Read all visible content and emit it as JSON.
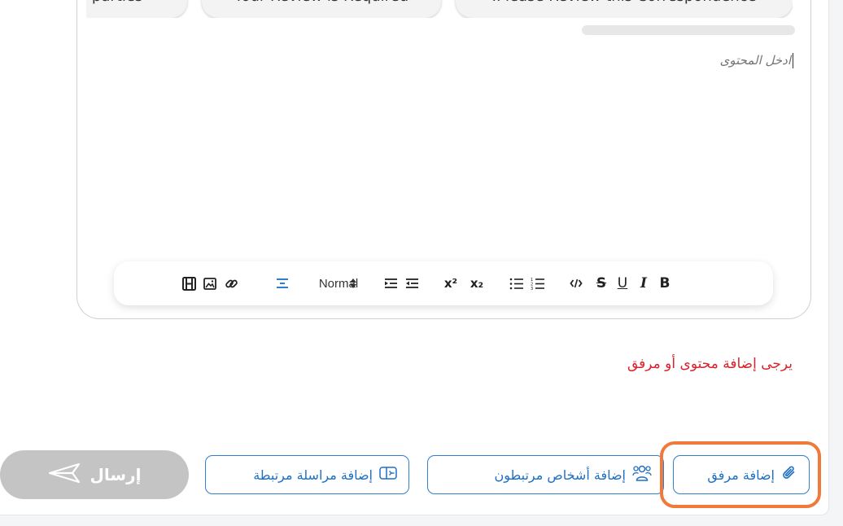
{
  "suggestions": [
    {
      "label": ".Please Review this Correspondence"
    },
    {
      "label": "Your Review is Required"
    },
    {
      "label": "ed parties"
    }
  ],
  "editor": {
    "placeholder": "ادخل المحتوى",
    "toolbar": {
      "normal_label": "Normal",
      "bold_label": "B",
      "italic_label": "I",
      "underline_label": "U",
      "strike_label": "S",
      "superscript_label": "x²",
      "subscript_label": "x₂"
    }
  },
  "validation": {
    "message": "يرجى إضافة محتوى أو مرفق"
  },
  "actions": {
    "add_attachment": "إضافة مرفق",
    "add_people": "إضافة أشخاص مرتبطون",
    "add_correspondence": "إضافة مراسلة مرتبطة",
    "send": "إرسال"
  },
  "colors": {
    "accent": "#2e7fd3",
    "error": "#d8232a",
    "highlight": "#f07a3a",
    "send_disabled": "#c4c4c4"
  },
  "icons": {
    "attachment": "paperclip-icon",
    "people": "people-icon",
    "correspondence": "linked-mail-icon",
    "send": "send-icon"
  }
}
